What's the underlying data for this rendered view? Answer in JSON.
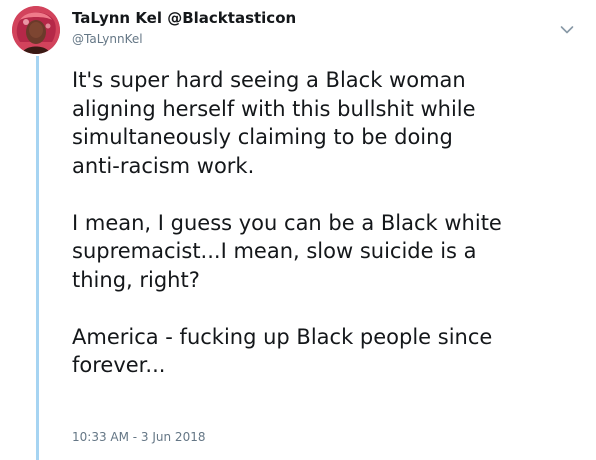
{
  "tweet": {
    "display_name": "TaLynn Kel @Blacktasticon",
    "handle": "@TaLynnKel",
    "paragraphs": [
      "It's super hard seeing a Black woman\naligning herself with this bullshit while\nsimultaneously claiming to be doing\nanti-racism work.",
      "I mean, I guess you can be a Black white\nsupremacist...I mean, slow suicide is a\nthing, right?",
      "America - fucking up Black people since\nforever..."
    ],
    "timestamp": "10:33 AM - 3 Jun 2018"
  },
  "icons": {
    "avatar": "profile-photo",
    "menu": "chevron-down-icon"
  },
  "colors": {
    "thread_line": "#a6d4f2",
    "text": "#14171a",
    "muted": "#657786"
  }
}
